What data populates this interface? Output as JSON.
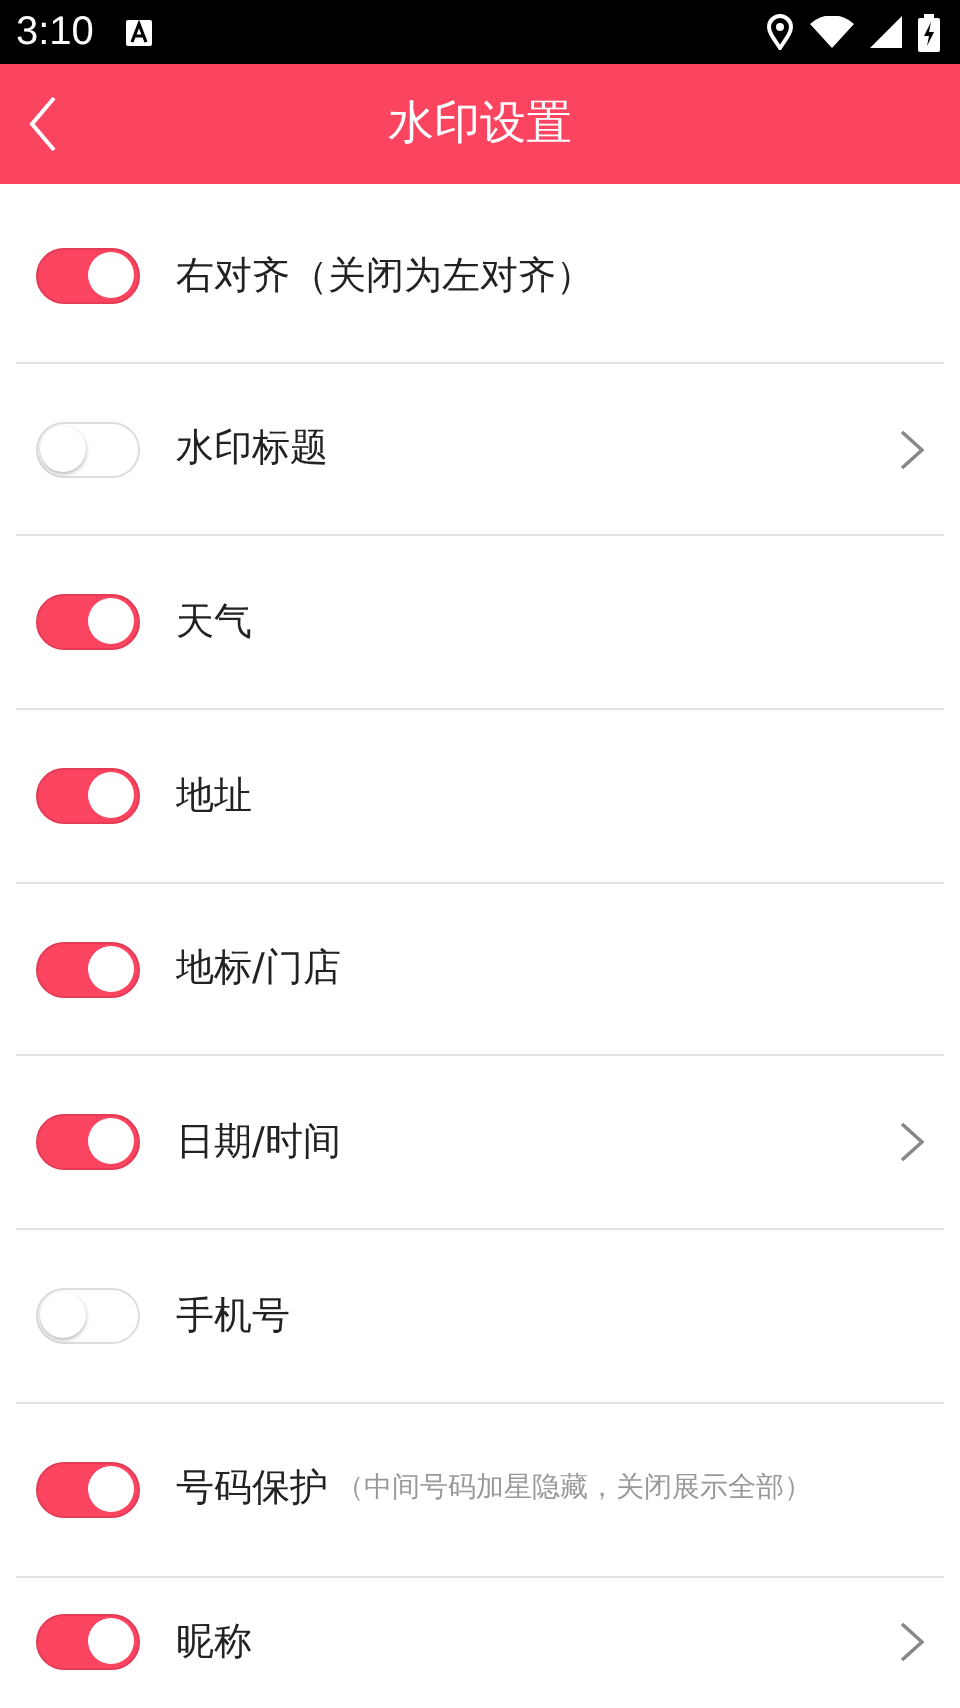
{
  "status_bar": {
    "time": "3:10"
  },
  "header": {
    "title": "水印设置"
  },
  "settings": [
    {
      "label": "右对齐（关闭为左对齐）",
      "on": true,
      "has_arrow": false
    },
    {
      "label": "水印标题",
      "on": false,
      "has_arrow": true
    },
    {
      "label": "天气",
      "on": true,
      "has_arrow": false
    },
    {
      "label": "地址",
      "on": true,
      "has_arrow": false
    },
    {
      "label": "地标/门店",
      "on": true,
      "has_arrow": false
    },
    {
      "label": "日期/时间",
      "on": true,
      "has_arrow": true
    },
    {
      "label": "手机号",
      "on": false,
      "has_arrow": false
    },
    {
      "label": "号码保护",
      "hint": "（中间号码加星隐藏，关闭展示全部）",
      "on": true,
      "has_arrow": false
    },
    {
      "label": "昵称",
      "on": true,
      "has_arrow": true
    }
  ]
}
